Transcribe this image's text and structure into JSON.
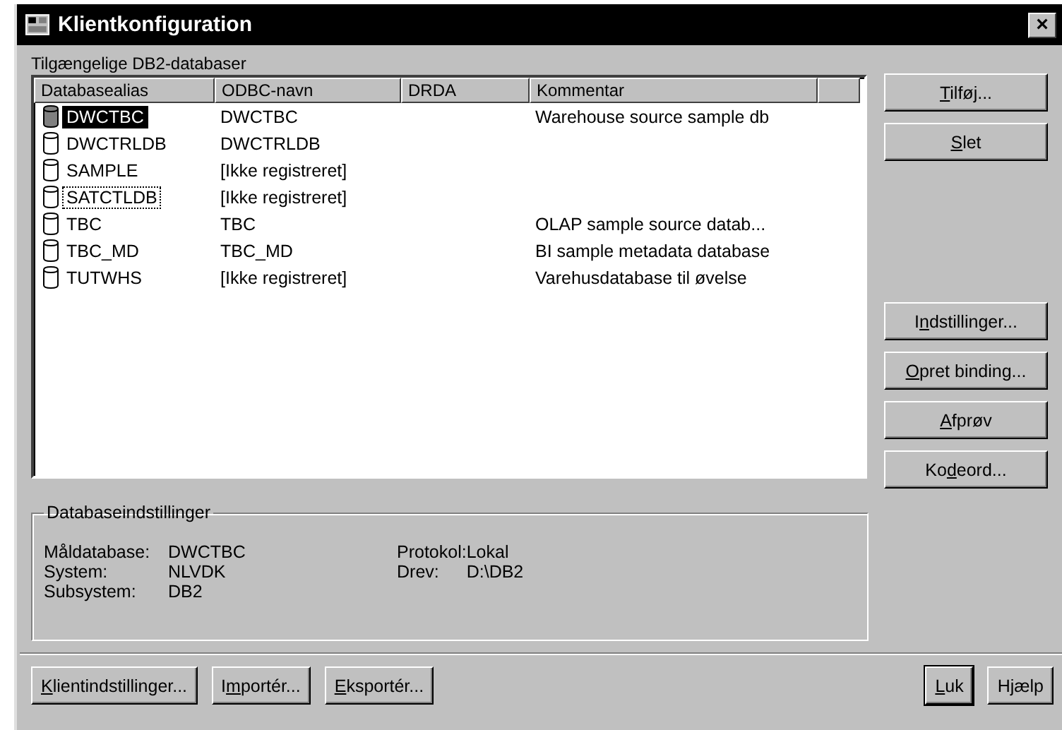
{
  "window": {
    "title": "Klientkonfiguration",
    "close": "×"
  },
  "list_label": "Tilgængelige DB2-databaser",
  "table": {
    "columns": [
      "Databasealias",
      "ODBC-navn",
      "DRDA",
      "Kommentar"
    ],
    "rows": [
      {
        "alias": "DWCTBC",
        "odbc": "DWCTBC",
        "comment": "Warehouse source sample db",
        "selected": true,
        "focused": false
      },
      {
        "alias": "DWCTRLDB",
        "odbc": "DWCTRLDB",
        "selected": false,
        "focused": false
      },
      {
        "alias": "SAMPLE",
        "odbc": "[Ikke registreret]",
        "selected": false,
        "focused": false
      },
      {
        "alias": "SATCTLDB",
        "odbc": "[Ikke registreret]",
        "selected": false,
        "focused": true
      },
      {
        "alias": "TBC",
        "odbc": "TBC",
        "comment": "OLAP sample source datab...",
        "selected": false,
        "focused": false
      },
      {
        "alias": "TBC_MD",
        "odbc": "TBC_MD",
        "comment": "BI sample metadata database",
        "selected": false,
        "focused": false
      },
      {
        "alias": "TUTWHS",
        "odbc": "[Ikke registreret]",
        "comment": "Varehusdatabase til øvelse",
        "selected": false,
        "focused": false
      }
    ]
  },
  "side_buttons_top": [
    {
      "parts": [
        {
          "text": "T",
          "key": true
        },
        {
          "text": "ilføj...",
          "key": false
        }
      ]
    },
    {
      "parts": [
        {
          "text": "S",
          "key": true
        },
        {
          "text": "let",
          "key": false
        }
      ]
    }
  ],
  "side_buttons_bottom": [
    {
      "parts": [
        {
          "text": "I",
          "key": false
        },
        {
          "text": "n",
          "key": true
        },
        {
          "text": "dstillinger...",
          "key": false
        }
      ]
    },
    {
      "parts": [
        {
          "text": "O",
          "key": true
        },
        {
          "text": "pret binding...",
          "key": false
        }
      ]
    },
    {
      "parts": [
        {
          "text": "A",
          "key": true
        },
        {
          "text": "fprøv",
          "key": false
        }
      ]
    },
    {
      "parts": [
        {
          "text": "Ko",
          "key": false
        },
        {
          "text": "d",
          "key": true
        },
        {
          "text": "eord...",
          "key": false
        }
      ]
    }
  ],
  "settings": {
    "title": "Databaseindstillinger",
    "left": [
      {
        "label": "Måldatabase:",
        "value": "DWCTBC"
      },
      {
        "label": "System:",
        "value": "NLVDK"
      },
      {
        "label": "Subsystem:",
        "value": "DB2"
      }
    ],
    "right": [
      {
        "label": "Protokol:",
        "value": "Lokal"
      },
      {
        "label": "Drev:",
        "value": "D:\\DB2"
      }
    ]
  },
  "bottom_buttons_left": [
    {
      "default": false,
      "parts": [
        {
          "text": "K",
          "key": true
        },
        {
          "text": "lientindstillinger...",
          "key": false
        }
      ]
    },
    {
      "default": false,
      "parts": [
        {
          "text": "I",
          "key": false
        },
        {
          "text": "m",
          "key": true
        },
        {
          "text": "portér...",
          "key": false
        }
      ]
    },
    {
      "default": false,
      "parts": [
        {
          "text": "E",
          "key": true
        },
        {
          "text": "ksportér...",
          "key": false
        }
      ]
    }
  ],
  "bottom_buttons_right": [
    {
      "default": true,
      "parts": [
        {
          "text": "L",
          "key": true
        },
        {
          "text": "uk",
          "key": false
        }
      ]
    },
    {
      "default": false,
      "parts": [
        {
          "text": "Hjælp",
          "key": false
        }
      ]
    }
  ]
}
